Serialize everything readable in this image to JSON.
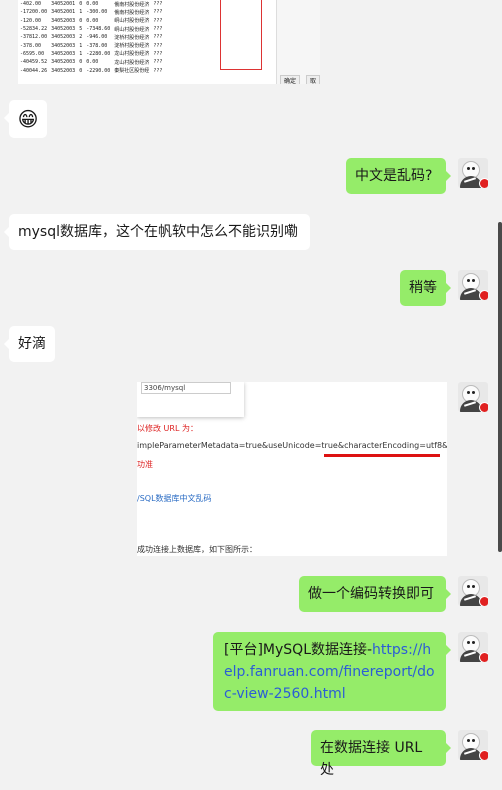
{
  "screenshot1": {
    "rows": [
      [
        "-402.00",
        "34052001",
        "0",
        "0.00",
        "俄南村股份经济",
        "???"
      ],
      [
        "-17200.00",
        "34052001",
        "1",
        "-300.00",
        "俄南村股份经济",
        "???"
      ],
      [
        "-120.00",
        "34052003",
        "0",
        "0.00",
        "峒山村股份经济",
        "???"
      ],
      [
        "-52834.22",
        "34052003",
        "5",
        "-7348.60",
        "峒山村股份经济",
        "???"
      ],
      [
        "-37812.00",
        "34052003",
        "2",
        "-946.00",
        "淀桥村股份经济",
        "???"
      ],
      [
        "-378.00",
        "34052003",
        "1",
        "-378.00",
        "淀桥村股份经济",
        "???"
      ],
      [
        "-6595.00",
        "34052003",
        "1",
        "-2280.00",
        "龙山村股份经济",
        "???"
      ],
      [
        "-40459.52",
        "34052003",
        "0",
        "0.00",
        "龙山村股份经济",
        "???"
      ],
      [
        "-40044.26",
        "34052003",
        "0",
        "-2290.00",
        "秦梨社区股份经",
        "???"
      ]
    ],
    "btn_ok": "确定",
    "btn_cancel": "取消"
  },
  "messages": {
    "m1_emoji": "😁",
    "m2": "中文是乱码?",
    "m3": "mysql数据库，这个在帆软中怎么不能识别嘞",
    "m4": "稍等",
    "m5": "好滴",
    "m7": "做一个编码转换即可",
    "m8_prefix": "[平台]MySQL数据连接-",
    "m8_link": "https://help.fanruan.com/finereport/doc-view-2560.html",
    "m9": "在数据连接 URL 处"
  },
  "screenshot2": {
    "dropdown_value": "3306/mysql",
    "line1": "以修改 URL 为：",
    "line2": "impleParameterMetadata=true&useUnicode=true&characterEncoding=utf8&useS",
    "line3": "功准",
    "line4": "/SQL数据库中文乱码",
    "line5": "成功连接上数据库，如下图所示："
  }
}
